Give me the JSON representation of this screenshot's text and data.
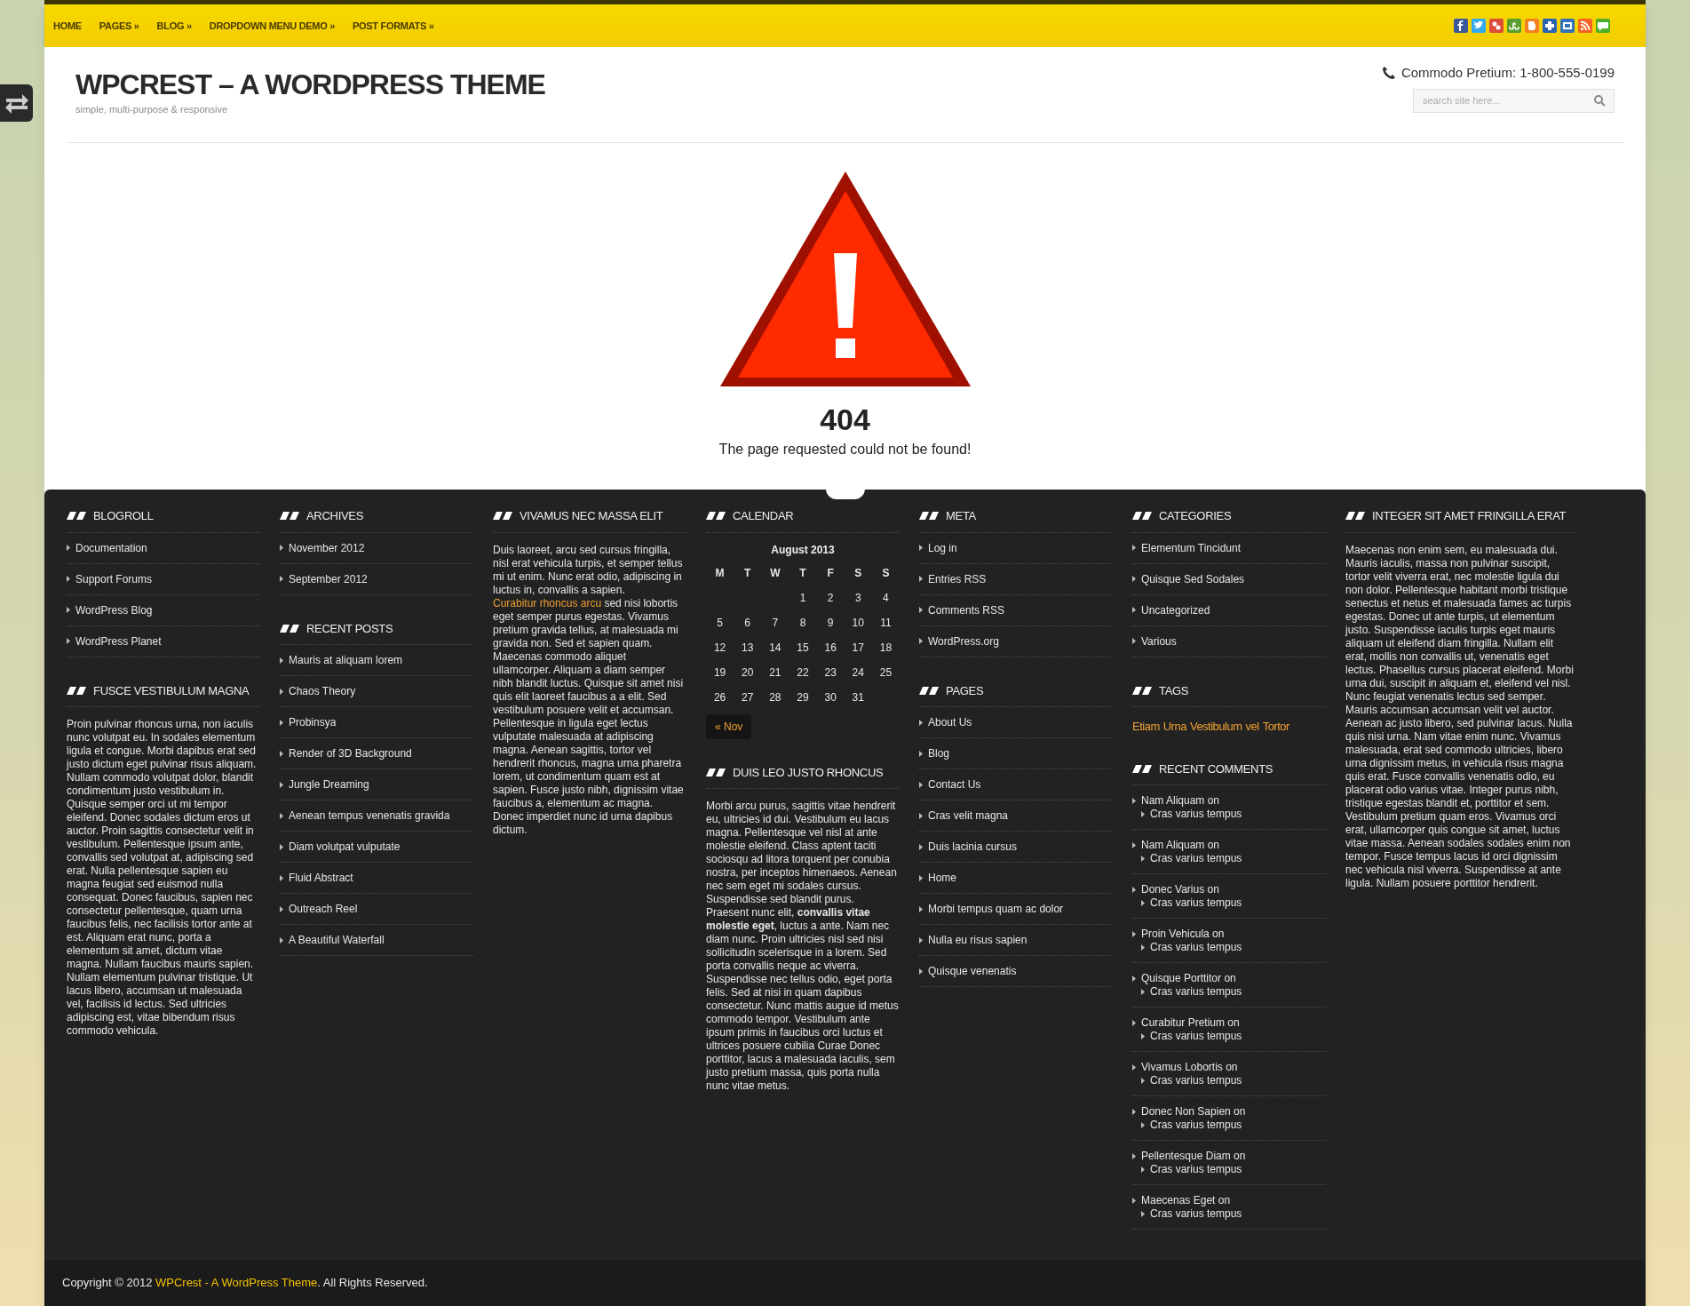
{
  "nav": {
    "items": [
      {
        "label": "HOME"
      },
      {
        "label": "PAGES »"
      },
      {
        "label": "BLOG »"
      },
      {
        "label": "DROPDOWN MENU DEMO »"
      },
      {
        "label": "POST FORMATS »"
      }
    ],
    "social": [
      {
        "kind": "facebook",
        "color": "#3b5998"
      },
      {
        "kind": "twitter",
        "color": "#33aaee"
      },
      {
        "kind": "google",
        "color": "#dd4b39"
      },
      {
        "kind": "stumble",
        "color": "#5a9e2e"
      },
      {
        "kind": "blogger",
        "color": "#f48120"
      },
      {
        "kind": "plus",
        "color": "#2a63b4"
      },
      {
        "kind": "window",
        "color": "#3372b8"
      },
      {
        "kind": "rss",
        "color": "#f26522"
      },
      {
        "kind": "chat",
        "color": "#4caf26"
      }
    ]
  },
  "header": {
    "title": "WPCREST – A WORDPRESS THEME",
    "tagline": "simple, multi-purpose & responsive",
    "phone": "Commodo Pretium: 1-800-555-0199",
    "search": {
      "placeholder": "search site here..."
    }
  },
  "error": {
    "code": "404",
    "message": "The page requested could not be found!"
  },
  "footer": {
    "columns": [
      [
        {
          "kind": "links",
          "title": "BLOGROLL",
          "items": [
            "Documentation",
            "Support Forums",
            "WordPress Blog",
            "WordPress Planet"
          ]
        },
        {
          "kind": "text",
          "title": "FUSCE VESTIBULUM MAGNA",
          "paragraphs": [
            [
              {
                "kind": "plain",
                "text": "Proin pulvinar rhoncus urna, non iaculis nunc volutpat eu. In sodales elementum ligula et congue. Morbi dapibus erat sed justo dictum eget pulvinar risus aliquam. Nullam commodo volutpat dolor, blandit condimentum justo vestibulum in. Quisque semper orci ut mi tempor eleifend. Donec sodales dictum eros ut auctor. Proin sagittis consectetur velit in vestibulum. Pellentesque ipsum ante, convallis sed volutpat at, adipiscing sed erat. Nulla pellentesque sapien eu magna feugiat sed euismod nulla consequat. Donec faucibus, sapien nec consectetur pellentesque, quam urna faucibus felis, nec facilisis tortor ante at est. Aliquam erat nunc, porta a elementum sit amet, dictum vitae magna. Nullam faucibus mauris sapien. Nullam elementum pulvinar tristique. Ut lacus libero, accumsan ut malesuada vel, facilisis id lectus. Sed ultricies adipiscing est, vitae bibendum risus commodo vehicula."
              }
            ]
          ]
        }
      ],
      [
        {
          "kind": "links",
          "title": "ARCHIVES",
          "items": [
            "November 2012",
            "September 2012"
          ]
        },
        {
          "kind": "links",
          "title": "RECENT POSTS",
          "items": [
            "Mauris at aliquam lorem",
            "Chaos Theory",
            "Probinsya",
            "Render of 3D Background",
            "Jungle Dreaming",
            "Aenean tempus venenatis gravida",
            "Diam volutpat vulputate",
            "Fluid Abstract",
            "Outreach Reel",
            "A Beautiful Waterfall"
          ]
        }
      ],
      [
        {
          "kind": "text",
          "title": "VIVAMUS NEC MASSA ELIT",
          "paragraphs": [
            [
              {
                "kind": "plain",
                "text": "Duis laoreet, arcu sed cursus fringilla, nisl erat vehicula turpis, et semper tellus mi ut enim. Nunc erat odio, adipiscing in luctus in, convallis a sapien. "
              },
              {
                "kind": "link",
                "text": "Curabitur rhoncus arcu"
              },
              {
                "kind": "plain",
                "text": " sed nisi lobortis eget semper purus egestas. Vivamus pretium gravida tellus, at malesuada mi gravida non. Sed et sapien quam. Maecenas commodo aliquet ullamcorper. Aliquam a diam semper nibh blandit luctus. Quisque sit amet nisi quis elit laoreet faucibus a a elit. Sed vestibulum posuere velit et accumsan. Pellentesque in ligula eget lectus vulputate malesuada at adipiscing magna. Aenean sagittis, tortor vel hendrerit rhoncus, magna urna pharetra lorem, ut condimentum quam est at sapien. Fusce justo nibh, dignissim vitae faucibus a, elementum ac magna. Donec imperdiet nunc id urna dapibus dictum."
              }
            ]
          ]
        }
      ],
      [
        {
          "kind": "calendar",
          "title": "CALENDAR",
          "caption": "August 2013",
          "weekdays": [
            "M",
            "T",
            "W",
            "T",
            "F",
            "S",
            "S"
          ],
          "weeks": [
            {
              "kind": "first",
              "days": [
                "1",
                "2",
                "3",
                "4"
              ]
            },
            {
              "kind": "full",
              "days": [
                "5",
                "6",
                "7",
                "8",
                "9",
                "10",
                "11"
              ]
            },
            {
              "kind": "full",
              "days": [
                "12",
                "13",
                "14",
                "15",
                "16",
                "17",
                "18"
              ]
            },
            {
              "kind": "full",
              "days": [
                "19",
                "20",
                "21",
                "22",
                "23",
                "24",
                "25"
              ]
            },
            {
              "kind": "last",
              "days": [
                "26",
                "27",
                "28",
                "29",
                "30",
                "31"
              ]
            }
          ],
          "prev": "« Nov"
        },
        {
          "kind": "text",
          "title": "DUIS LEO JUSTO RHONCUS",
          "paragraphs": [
            [
              {
                "kind": "plain",
                "text": "Morbi arcu purus, sagittis vitae hendrerit eu, ultricies id dui. Vestibulum eu lacus magna. Pellentesque vel nisl at ante molestie eleifend. Class aptent taciti sociosqu ad litora torquent per conubia nostra, per inceptos himenaeos. Aenean nec sem eget mi sodales cursus. Suspendisse sed blandit purus. Praesent nunc elit, **convallis vitae molestie eget**, luctus a ante. Nam nec diam nunc. Proin ultricies nisl sed nisi sollicitudin scelerisque in a lorem. Sed porta convallis neque ac viverra. Suspendisse nec tellus odio, eget porta felis. Sed at nisi in quam dapibus consectetur. Nunc mattis augue id metus commodo tempor. Vestibulum ante ipsum primis in faucibus orci luctus et ultrices posuere cubilia Curae Donec porttitor, lacus a malesuada iaculis, sem justo pretium massa, quis porta nulla nunc vitae metus."
              }
            ]
          ]
        }
      ],
      [
        {
          "kind": "links",
          "title": "META",
          "items": [
            "Log in",
            "Entries RSS",
            "Comments RSS",
            "WordPress.org"
          ]
        },
        {
          "kind": "links",
          "title": "PAGES",
          "items": [
            "About Us",
            "Blog",
            "Contact Us",
            "Cras velit magna",
            "Duis lacinia cursus",
            "Home",
            "Morbi tempus quam ac dolor",
            "Nulla eu risus sapien",
            "Quisque venenatis"
          ]
        }
      ],
      [
        {
          "kind": "links",
          "title": "CATEGORIES",
          "items": [
            "Elementum Tincidunt",
            "Quisque Sed Sodales",
            "Uncategorized",
            "Various"
          ]
        },
        {
          "kind": "tags",
          "title": "TAGS",
          "items": [
            "Etiam",
            "Urna",
            "Vestibulum",
            "vel",
            "Tortor"
          ]
        },
        {
          "kind": "comments",
          "title": "RECENT COMMENTS",
          "items": [
            {
              "author": "Nam Aliquam on",
              "post": "Cras varius tempus"
            },
            {
              "author": "Nam Aliquam on",
              "post": "Cras varius tempus"
            },
            {
              "author": "Donec Varius on",
              "post": "Cras varius tempus"
            },
            {
              "author": "Proin Vehicula on",
              "post": "Cras varius tempus"
            },
            {
              "author": "Quisque Porttitor on",
              "post": "Cras varius tempus"
            },
            {
              "author": "Curabitur Pretium on",
              "post": "Cras varius tempus"
            },
            {
              "author": "Vivamus Lobortis on",
              "post": "Cras varius tempus"
            },
            {
              "author": "Donec Non Sapien on",
              "post": "Cras varius tempus"
            },
            {
              "author": "Pellentesque Diam on",
              "post": "Cras varius tempus"
            },
            {
              "author": "Maecenas Eget on",
              "post": "Cras varius tempus"
            }
          ]
        }
      ],
      [
        {
          "kind": "text",
          "title": "INTEGER SIT AMET FRINGILLA ERAT",
          "paragraphs": [
            [
              {
                "kind": "plain",
                "text": "Maecenas non enim sem, eu malesuada dui. Mauris iaculis, massa non pulvinar suscipit, tortor velit viverra erat, nec molestie ligula dui non dolor. Pellentesque habitant morbi tristique senectus et netus et malesuada fames ac turpis egestas. Donec ut ante turpis, ut elementum justo. Suspendisse iaculis turpis eget mauris aliquam ut eleifend diam fringilla. Nullam elit erat, mollis non convallis ut, venenatis eget lectus. Phasellus cursus placerat eleifend. Morbi urna dui, suscipit in aliquam et, eleifend vel nisl."
              }
            ],
            [
              {
                "kind": "plain",
                "text": "Nunc feugiat venenatis lectus sed semper. Mauris accumsan accumsan velit vel auctor. Aenean ac justo libero, sed pulvinar lacus. Nulla quis nisi urna. Nam vitae enim nunc. Vivamus malesuada, erat sed commodo ultricies, libero urna dignissim metus, in vehicula risus magna quis erat. Fusce convallis venenatis odio, eu placerat odio varius vitae. Integer purus nibh, tristique egestas blandit et, porttitor et sem. Vestibulum pretium quam eros. Vivamus orci erat, ullamcorper quis congue sit amet, luctus vitae massa. Aenean sodales sodales enim non tempor. Fusce tempus lacus id orci dignissim nec vehicula nisl viverra. Suspendisse at ante ligula. Nullam posuere porttitor hendrerit."
              }
            ]
          ]
        }
      ]
    ]
  },
  "copyright": [
    {
      "kind": "plain",
      "text": "Copyright © 2012 "
    },
    {
      "kind": "link",
      "text": "WPCrest - A WordPress Theme"
    },
    {
      "kind": "plain",
      "text": ". All Rights Reserved."
    }
  ]
}
